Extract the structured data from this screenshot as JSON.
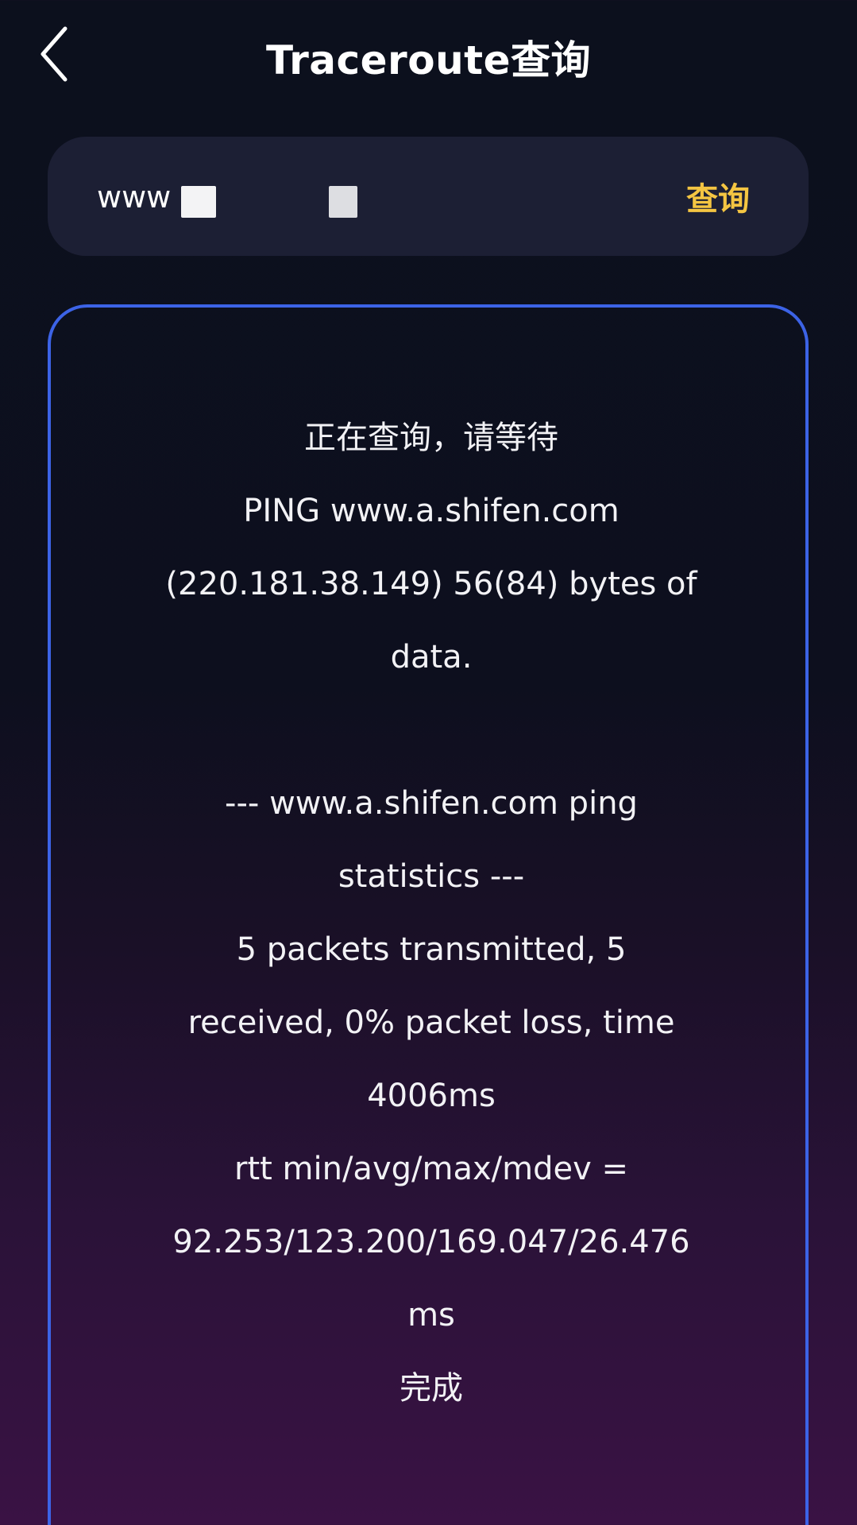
{
  "header": {
    "title": "Traceroute查询"
  },
  "search": {
    "value": "www",
    "button_label": "查询"
  },
  "result": {
    "lines": [
      "正在查询，请等待",
      "PING www.a.shifen.com",
      "(220.181.38.149) 56(84) bytes of",
      "data.",
      "",
      "--- www.a.shifen.com ping",
      "statistics ---",
      "5 packets transmitted, 5",
      "received, 0% packet loss, time",
      "4006ms",
      "rtt min/avg/max/mdev =",
      "92.253/123.200/169.047/26.476",
      "ms",
      "完成"
    ]
  },
  "colors": {
    "accent": "#f4c542",
    "card_border": "#3c63e6",
    "search_bg": "#1c1f34"
  },
  "icons": {
    "back": "chevron-left-icon"
  }
}
